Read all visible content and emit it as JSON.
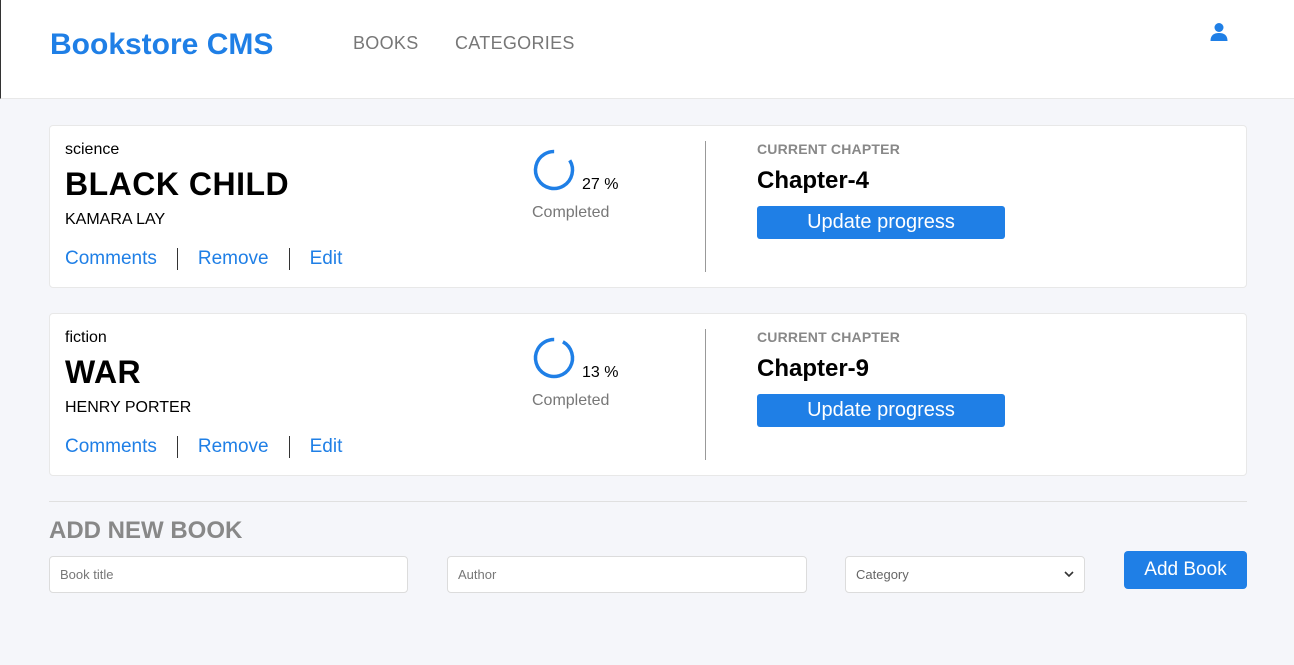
{
  "header": {
    "logo": "Bookstore CMS",
    "nav": [
      "BOOKS",
      "CATEGORIES"
    ],
    "user_icon": "user-icon"
  },
  "colors": {
    "accent": "#1f7fe6",
    "muted": "#777777",
    "background": "#f5f6fa"
  },
  "books": [
    {
      "genre": "science",
      "title": "BLACK CHILD",
      "author": "KAMARA LAY",
      "actions": [
        "Comments",
        "Remove",
        "Edit"
      ],
      "progress": 27,
      "progress_text": "27 %",
      "completed_label": "Completed",
      "chapter_label": "CURRENT CHAPTER",
      "chapter": "Chapter-4",
      "update_label": "Update progress"
    },
    {
      "genre": "fiction",
      "title": "WAR",
      "author": "HENRY PORTER",
      "actions": [
        "Comments",
        "Remove",
        "Edit"
      ],
      "progress": 13,
      "progress_text": "13 %",
      "completed_label": "Completed",
      "chapter_label": "CURRENT CHAPTER",
      "chapter": "Chapter-9",
      "update_label": "Update progress"
    }
  ],
  "form": {
    "heading": "ADD NEW BOOK",
    "title_placeholder": "Book title",
    "author_placeholder": "Author",
    "category_selected": "Category",
    "submit_label": "Add Book"
  }
}
